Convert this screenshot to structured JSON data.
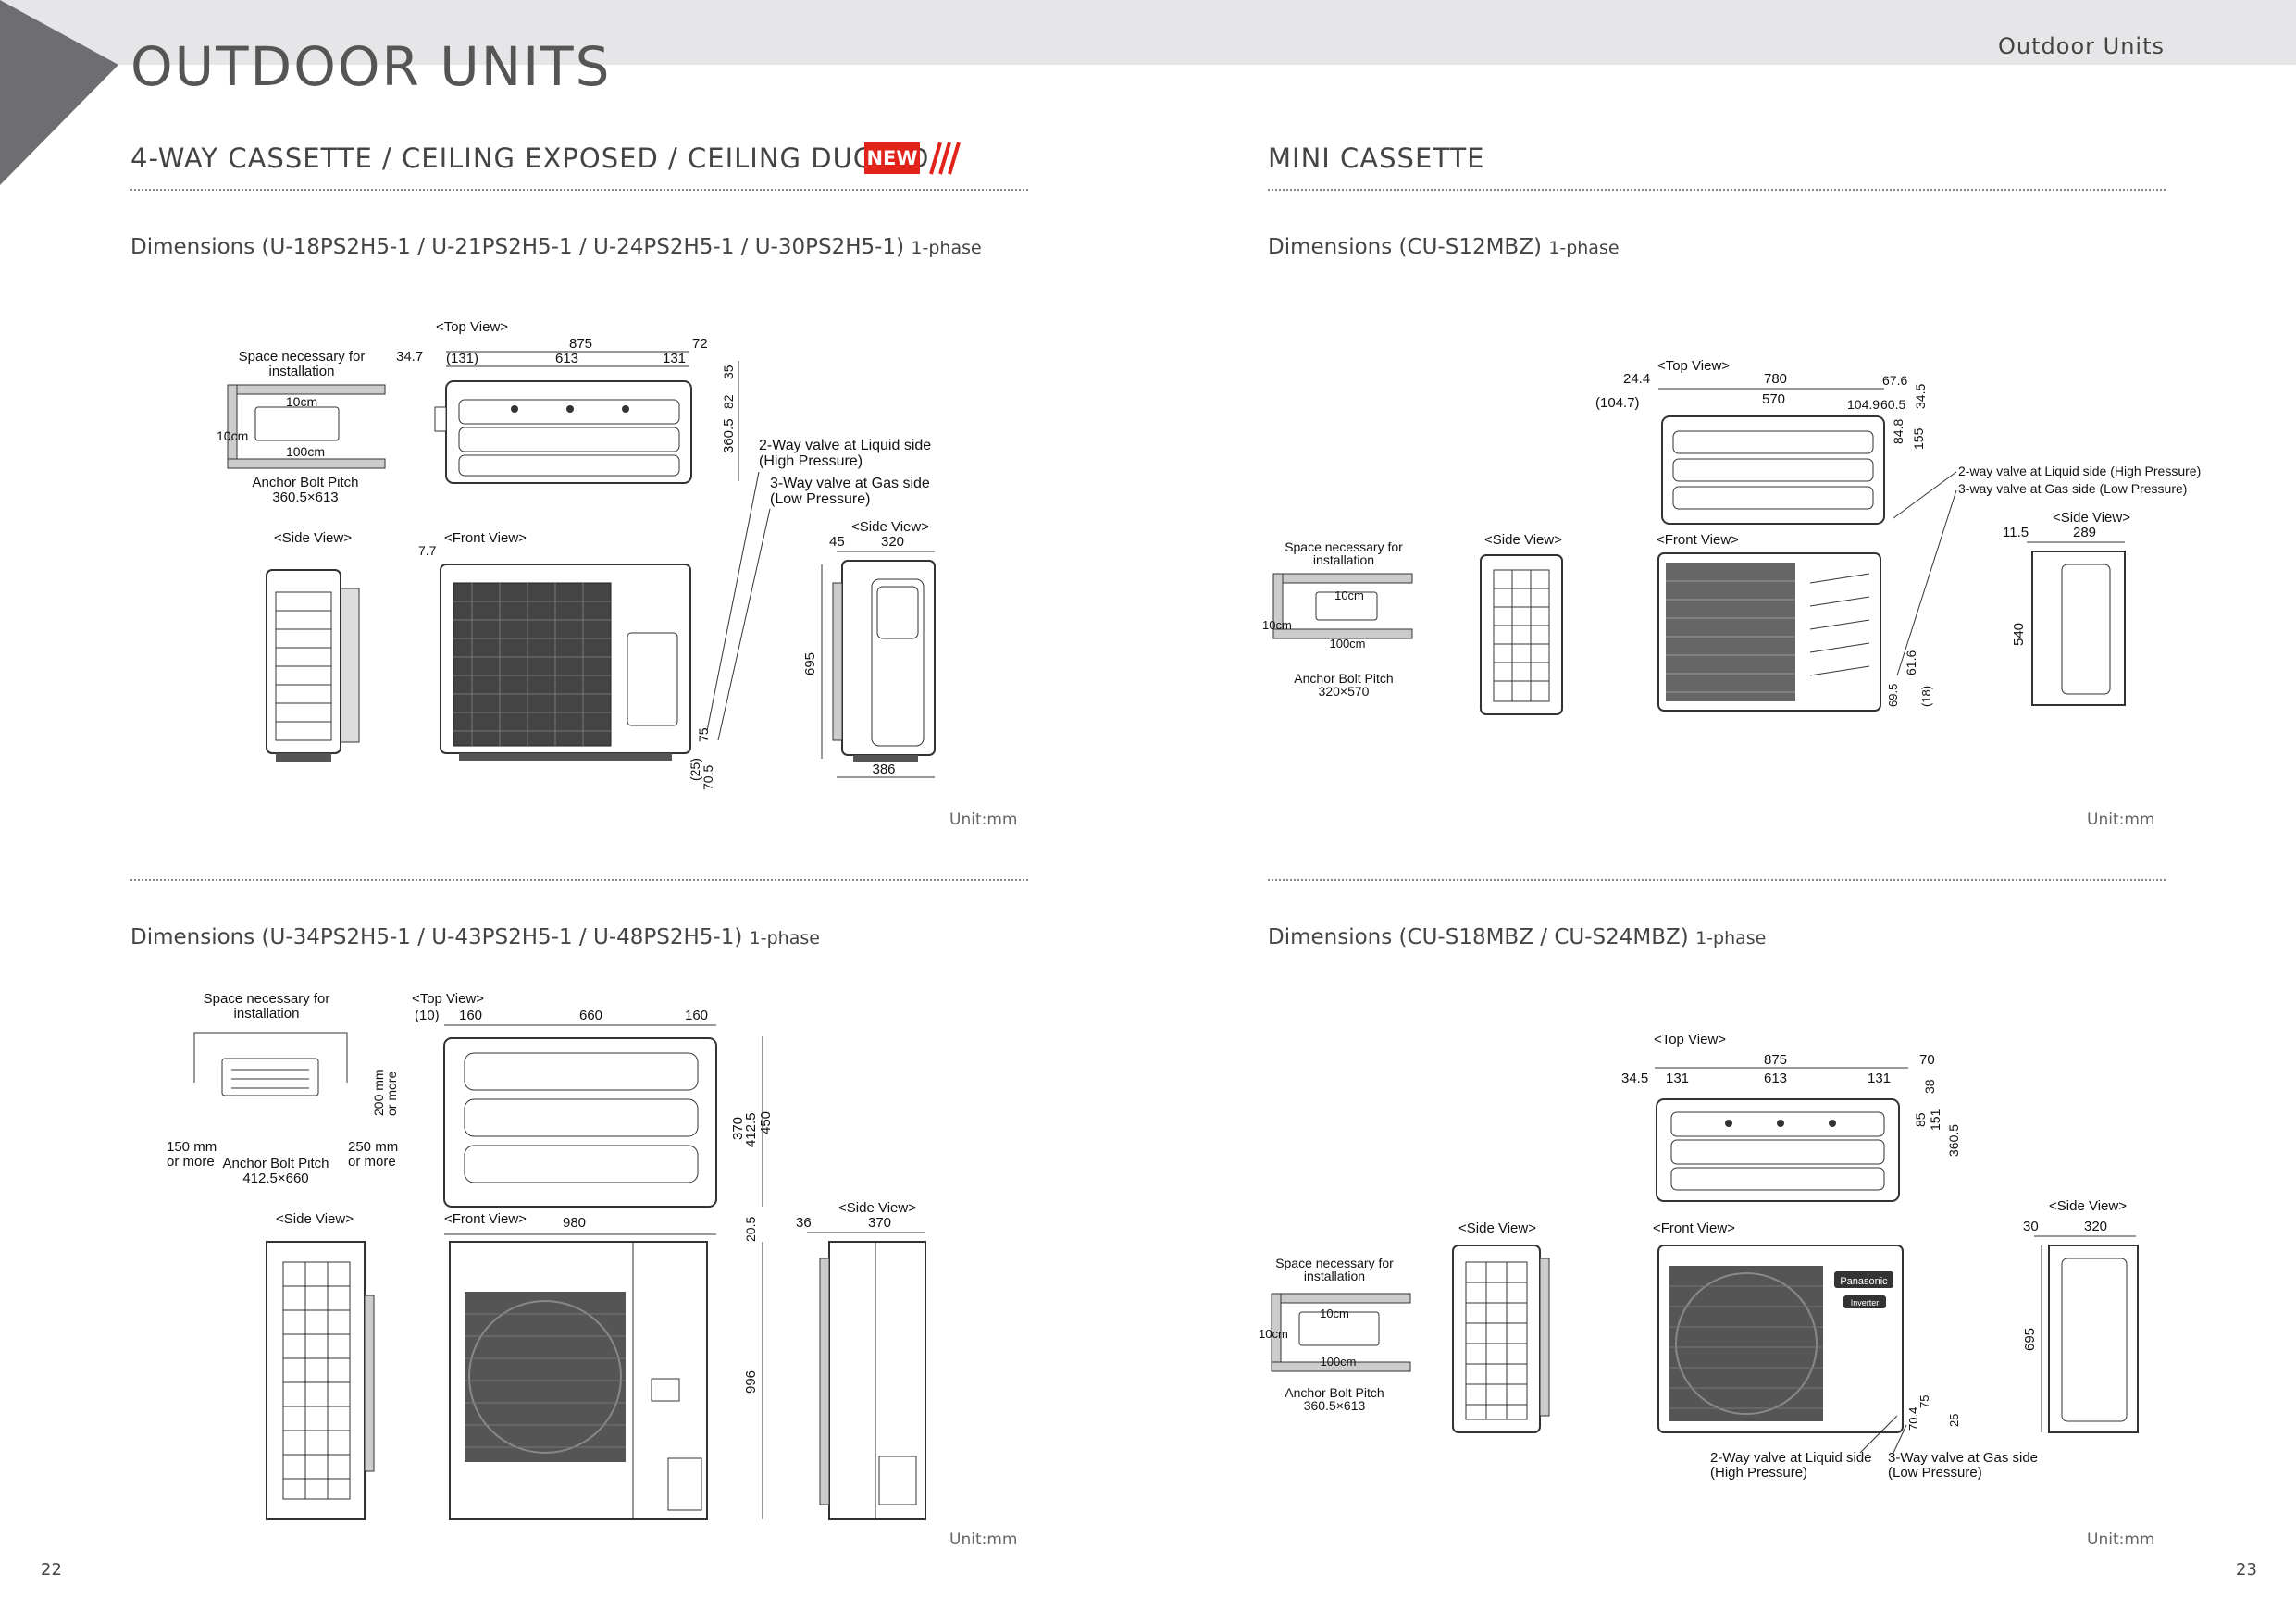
{
  "header": {
    "page_title": "OUTDOOR UNITS",
    "section_tag": "Outdoor Units"
  },
  "left": {
    "heading": "4-WAY CASSETTE / CEILING EXPOSED / CEILING DUCTED",
    "badge": "NEW",
    "block1": {
      "title": "Dimensions (U-18PS2H5-1 / U-21PS2H5-1 / U-24PS2H5-1 / U-30PS2H5-1)",
      "phase": "1-phase",
      "unit": "Unit:mm",
      "labels": {
        "space": "Space necessary for",
        "space2": "installation",
        "c10a": "10cm",
        "c10b": "10cm",
        "c100": "100cm",
        "anchor": "Anchor Bolt Pitch",
        "anchor_val": "360.5×613",
        "top_view": "<Top View>",
        "side_view": "<Side View>",
        "front_view": "<Front View>",
        "side_view2": "<Side View>",
        "d875": "875",
        "d72": "72",
        "d347": "34.7",
        "d131a": "(131)",
        "d613": "613",
        "d131b": "131",
        "d35": "35",
        "d82": "82",
        "d3605": "360.5",
        "valve_liq": "2-Way valve at Liquid side",
        "valve_liq2": "(High Pressure)",
        "valve_gas": "3-Way valve at Gas side",
        "valve_gas2": "(Low Pressure)",
        "d77": "7.7",
        "d45": "45",
        "d320": "320",
        "d695": "695",
        "d386": "386",
        "d75": "75",
        "d25": "(25)",
        "d705": "70.5"
      }
    },
    "block2": {
      "title": "Dimensions (U-34PS2H5-1 / U-43PS2H5-1 / U-48PS2H5-1)",
      "phase": "1-phase",
      "unit": "Unit:mm",
      "labels": {
        "space": "Space necessary for",
        "space2": "installation",
        "top_view": "<Top View>",
        "d10": "(10)",
        "d160a": "160",
        "d660": "660",
        "d160b": "160",
        "d200": "200 mm",
        "d200b": "or more",
        "d150": "150 mm",
        "d150b": "or more",
        "anchor": "Anchor Bolt Pitch",
        "anchor_val": "412.5×660",
        "d250": "250 mm",
        "d250b": "or more",
        "d370v": "370",
        "d4125": "412.5",
        "d450": "450",
        "d980": "980",
        "d205": "20.5",
        "side_view": "<Side View>",
        "front_view": "<Front View>",
        "side_view2": "<Side View>",
        "d36": "36",
        "d370": "370",
        "d996": "996"
      }
    }
  },
  "right": {
    "heading": "MINI CASSETTE",
    "block1": {
      "title": "Dimensions (CU-S12MBZ)",
      "phase": "1-phase",
      "unit": "Unit:mm",
      "labels": {
        "top_view": "<Top View>",
        "d244": "24.4",
        "d780": "780",
        "d676": "67.6",
        "d1047": "(104.7)",
        "d570": "570",
        "d1049": "104.9",
        "d605": "60.5",
        "d345": "34.5",
        "d848": "84.8",
        "d155": "155",
        "valve_liq": "2-way valve at Liquid side (High Pressure)",
        "valve_gas": "3-way valve at Gas side (Low Pressure)",
        "side_view": "<Side View>",
        "front_view": "<Front View>",
        "side_view2": "<Side View>",
        "d115": "11.5",
        "d289": "289",
        "space": "Space necessary for",
        "space2": "installation",
        "c10a": "10cm",
        "c10b": "10cm",
        "c100": "100cm",
        "anchor": "Anchor Bolt Pitch",
        "anchor_val": "320×570",
        "d540": "540",
        "d616": "61.6",
        "d695": "69.5",
        "d18": "(18)"
      }
    },
    "block2": {
      "title": "Dimensions (CU-S18MBZ / CU-S24MBZ)",
      "phase": "1-phase",
      "unit": "Unit:mm",
      "labels": {
        "top_view": "<Top View>",
        "d875": "875",
        "d70": "70",
        "d345": "34.5",
        "d131a": "131",
        "d613": "613",
        "d131b": "131",
        "d38": "38",
        "d85": "85",
        "d151": "151",
        "d3605": "360.5",
        "side_view": "<Side View>",
        "front_view": "<Front View>",
        "side_view2": "<Side View>",
        "d30": "30",
        "d320": "320",
        "space": "Space necessary for",
        "space2": "installation",
        "c10a": "10cm",
        "c10b": "10cm",
        "c100": "100cm",
        "anchor": "Anchor Bolt Pitch",
        "anchor_val": "360.5×613",
        "d695": "695",
        "d704": "70.4",
        "d75": "75",
        "d25": "25",
        "valve_liq": "2-Way valve at Liquid side",
        "valve_liq2": "(High Pressure)",
        "valve_gas": "3-Way valve at Gas side",
        "valve_gas2": "(Low Pressure)",
        "brand": "Panasonic",
        "brand2": "Inverter"
      }
    }
  },
  "footer": {
    "page_left": "22",
    "page_right": "23"
  },
  "colors": {
    "accent_red": "#e2231a",
    "header_gray": "#e6e6e8",
    "corner_gray": "#6e6e70"
  }
}
